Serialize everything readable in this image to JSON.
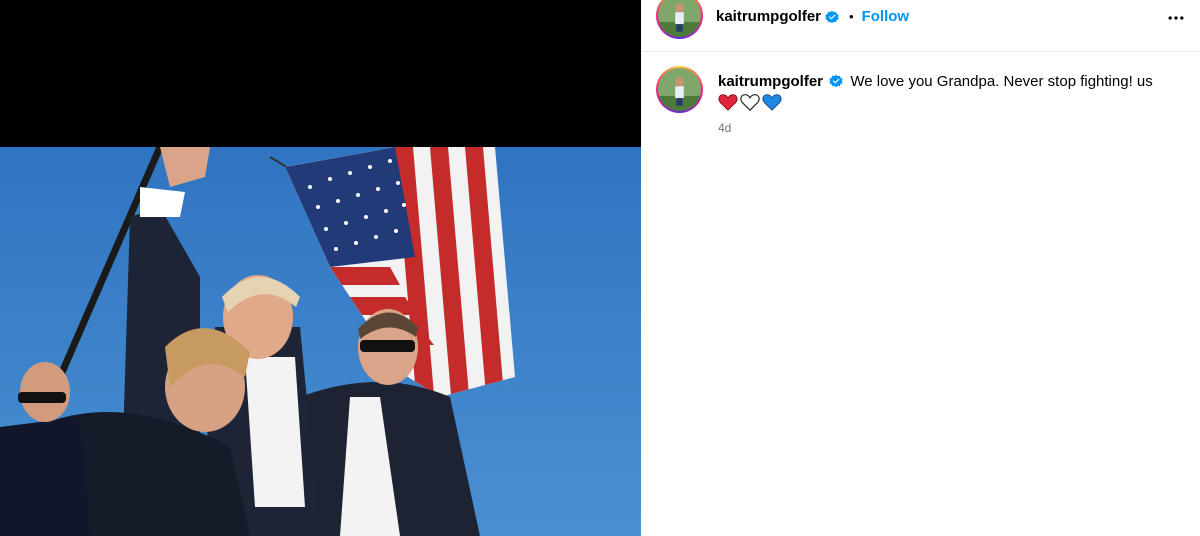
{
  "post": {
    "username": "kaitrumpgolfer",
    "verified": true,
    "separator": "•",
    "follow_label": "Follow",
    "more_icon": "more-options-icon",
    "caption": "We love you Grandpa. Never stop fighting! us",
    "emojis": [
      "red-heart-icon",
      "white-heart-icon",
      "blue-heart-icon"
    ],
    "timestamp": "4d"
  },
  "colors": {
    "follow_blue": "#0095f6",
    "verified_blue": "#0095f6",
    "timestamp_gray": "#737373",
    "sky_blue": "#3b82c4"
  }
}
